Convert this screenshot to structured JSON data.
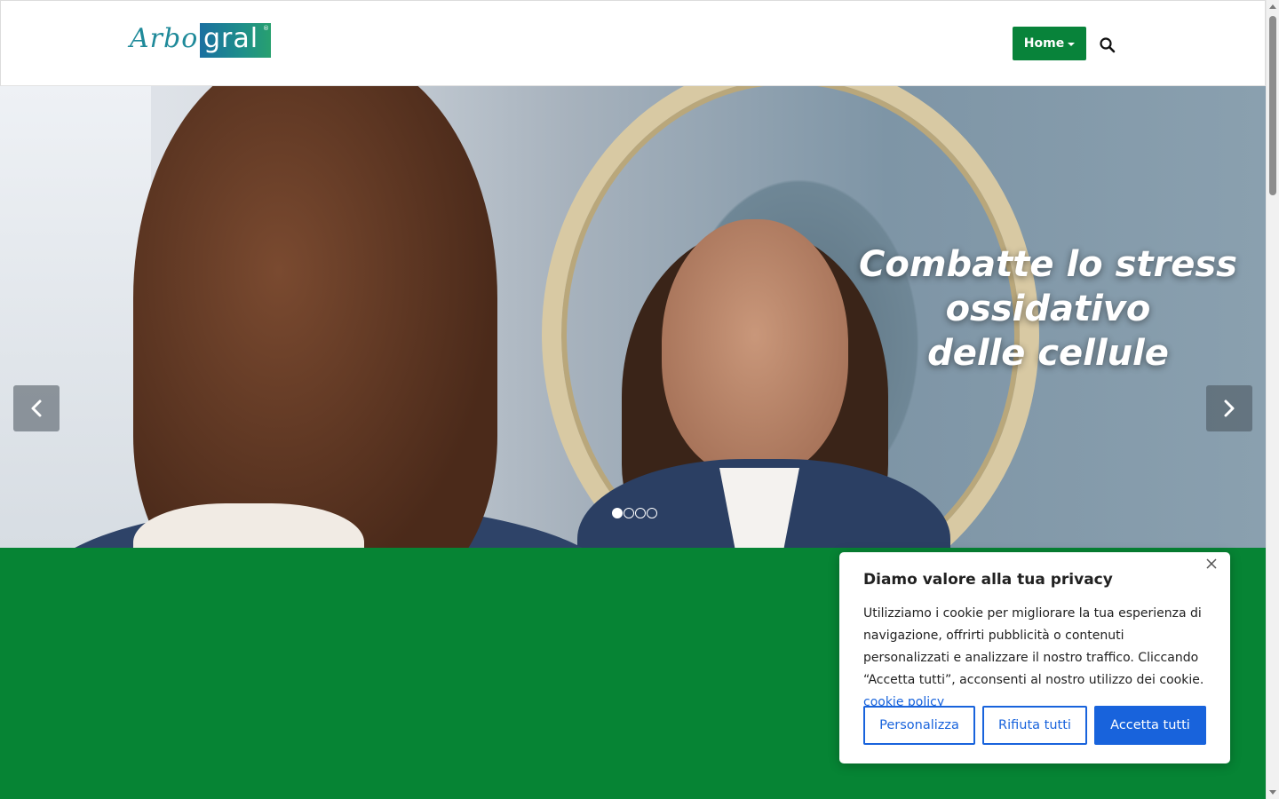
{
  "header": {
    "logo_left": "Arbo",
    "logo_right": "gral",
    "logo_mark": "®",
    "home_label": "Home",
    "search_icon": "search-icon"
  },
  "hero": {
    "caption_lines": [
      "Combatte lo stress",
      "ossidativo",
      "delle cellule"
    ],
    "prev_icon": "chevron-left-icon",
    "next_icon": "chevron-right-icon",
    "slides_total": 4,
    "active_slide": 1
  },
  "colors": {
    "brand_green": "#068434",
    "button_green": "#08833a",
    "cookie_blue": "#1863dc",
    "logo_teal": "#1f8a9a"
  },
  "cookie": {
    "close_icon": "close-icon",
    "title": "Diamo valore alla tua privacy",
    "body": "Utilizziamo i cookie per migliorare la tua esperienza di navigazione, offrirti pubblicità o contenuti personalizzati e analizzare il nostro traffico. Cliccando “Accetta tutti”, acconsenti al nostro utilizzo dei cookie.",
    "policy_link": "cookie policy",
    "buttons": {
      "customize": "Personalizza",
      "reject": "Rifiuta tutti",
      "accept": "Accetta tutti"
    }
  }
}
